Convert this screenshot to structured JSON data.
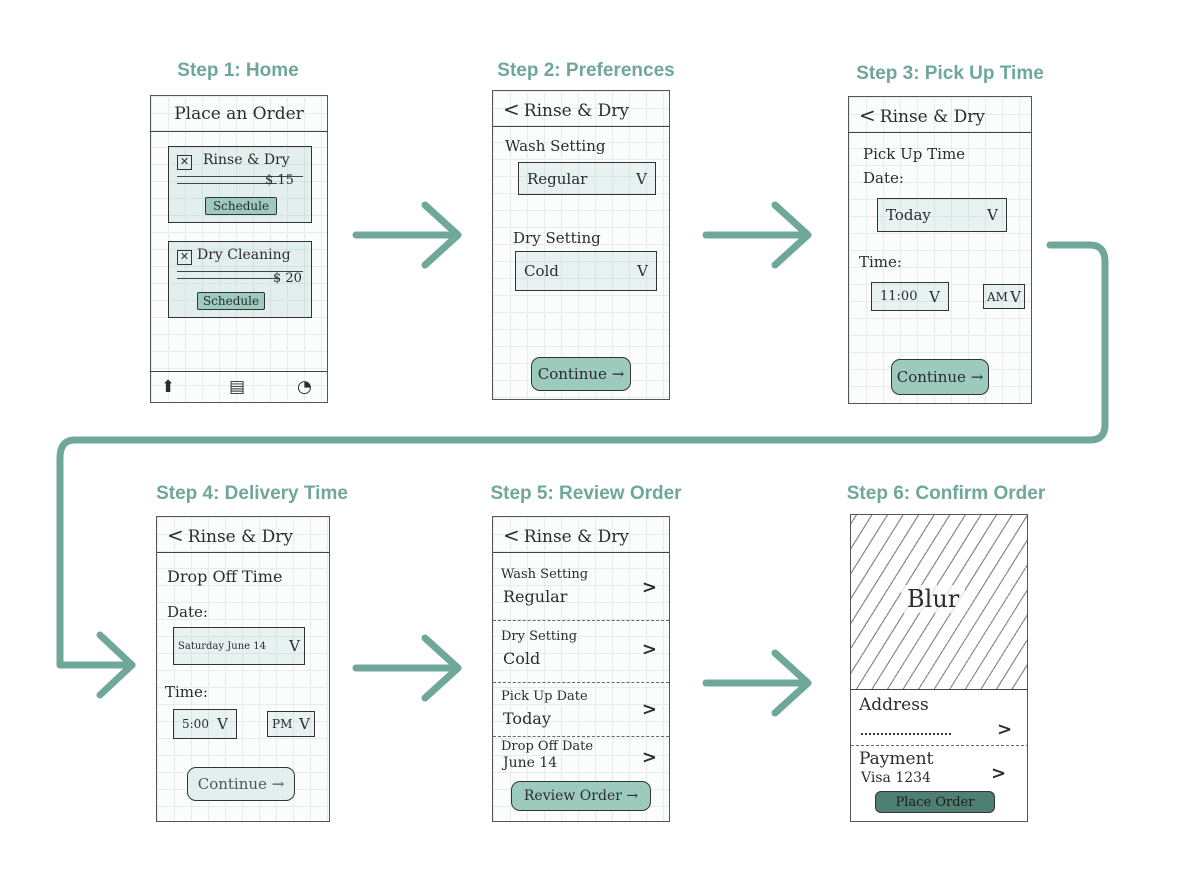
{
  "steps": [
    {
      "title": "Step 1: Home"
    },
    {
      "title": "Step 2: Preferences"
    },
    {
      "title": "Step 3: Pick Up Time"
    },
    {
      "title": "Step 4: Delivery Time"
    },
    {
      "title": "Step 5: Review Order"
    },
    {
      "title": "Step 6: Confirm Order"
    }
  ],
  "s1": {
    "header": "Place an Order",
    "cards": [
      {
        "name": "Rinse & Dry",
        "price": "$ 15",
        "button": "Schedule"
      },
      {
        "name": "Dry Cleaning",
        "price": "$ 20",
        "button": "Schedule"
      }
    ],
    "tabs": [
      "up-arrow-icon",
      "list-icon",
      "profile-icon"
    ]
  },
  "s2": {
    "back": "<",
    "header": "Rinse & Dry",
    "wash_label": "Wash Setting",
    "wash_value": "Regular",
    "dry_label": "Dry Setting",
    "dry_value": "Cold",
    "continue": "Continue →"
  },
  "s3": {
    "back": "<",
    "header": "Rinse & Dry",
    "title_1": "Pick Up Time",
    "date_label": "Date:",
    "date_value": "Today",
    "time_label": "Time:",
    "time_value": "11:00",
    "ampm_value": "AM",
    "continue": "Continue →"
  },
  "s4": {
    "back": "<",
    "header": "Rinse & Dry",
    "title": "Drop Off Time",
    "date_label": "Date:",
    "date_value": "Saturday June 14",
    "time_label": "Time:",
    "time_value": "5:00",
    "ampm_value": "PM",
    "continue": "Continue →"
  },
  "s5": {
    "back": "<",
    "header": "Rinse & Dry",
    "rows": [
      {
        "label": "Wash Setting",
        "value": "Regular"
      },
      {
        "label": "Dry Setting",
        "value": "Cold"
      },
      {
        "label": "Pick Up Date",
        "value": "Today"
      },
      {
        "label": "Drop Off Date",
        "value": "June 14"
      }
    ],
    "button": "Review Order →"
  },
  "s6": {
    "blur": "Blur",
    "address_label": "Address",
    "payment_label": "Payment",
    "payment_value": "Visa 1234",
    "button": "Place Order"
  },
  "glyphs": {
    "chevron_down": "V",
    "arrow_right": ">"
  },
  "colors": {
    "accent": "#6fa79a",
    "button": "#9ccabd"
  }
}
